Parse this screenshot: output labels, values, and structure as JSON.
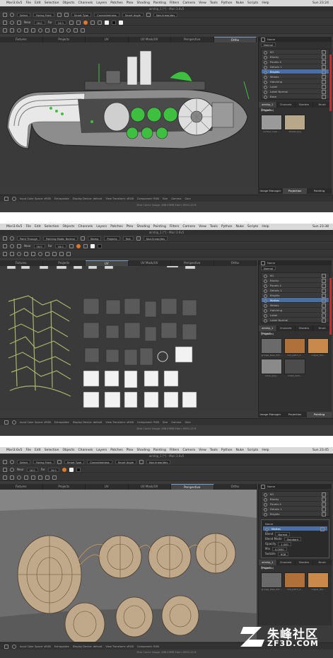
{
  "menu": [
    "Mari3.6v5",
    "File",
    "Edit",
    "Selection",
    "Objects",
    "Channels",
    "Layers",
    "Patches",
    "Ptex",
    "Shading",
    "Painting",
    "Filters",
    "Camera",
    "View",
    "Tools",
    "Python",
    "Nuke",
    "Scripts",
    "Help"
  ],
  "panels": [
    {
      "clock": "Sun 23:24",
      "title": "airship_1 [*] - Mari 3.6v5",
      "toolbar1": {
        "select": "Select",
        "mode": "Facing Front",
        "smart_type": "Smart Type",
        "mode2": "Connectedness",
        "smart_angle": "Smart Angle",
        "preset": "Non-linear/dev"
      },
      "toolbar2": {
        "near": "Near",
        "far": "Far",
        "size": "16.0",
        "flow": "Flow"
      },
      "tabs": [
        "Fixtures",
        "Projects",
        "UV",
        "UV Mask/UV",
        "Perspective",
        "Ortho"
      ],
      "status": {
        "input": "Input Color Space: sRGB",
        "extrapolate": "Extrapolate",
        "display": "Display Device: default",
        "view": "View Transform: sRGB",
        "component": "Component: RGB",
        "size": "Size",
        "gamma": "Gamma",
        "gain": "Gain"
      },
      "cache": "Disk Cache Usage: 486.49MB   Eden: 6952.20 B",
      "side": {
        "title": "Name",
        "layers": [
          "KO",
          "Blocky",
          "Panels 4",
          "Details 1",
          "Brights",
          "Metals",
          "Hatching",
          "Label",
          "Label Normal",
          "Base"
        ],
        "selected": 4,
        "tabs": [
          "airship_1 (Projects)",
          "Channels",
          "Shaders",
          "Brush"
        ],
        "project_label": "Project",
        "thumbs": [
          "surface noise ...",
          "streaks.png"
        ],
        "bottom_tabs": [
          "Image Manager",
          "Projection",
          "Painting"
        ]
      }
    },
    {
      "clock": "Sun 23:38",
      "title": "airship_1 [*] - Mari 3.6v5",
      "toolbar1": {
        "select": "Paint Through",
        "mode": "Painting Mode: Normal",
        "smart_type": "Stamp",
        "mode2": "Projects",
        "smart_angle": "Text",
        "preset": "Non-linear/dev"
      },
      "toolbar2": {
        "near": "Near",
        "far": "Far",
        "size": "16.0",
        "flow": "Flow"
      },
      "tabs": [
        "Fixtures",
        "Projects",
        "UV",
        "UV Mask/UV",
        "Perspective",
        "Ortho"
      ],
      "status": {
        "input": "Input Color Space: sRGB",
        "extrapolate": "Extrapolate",
        "display": "Display Device: default",
        "view": "View Transform: sRGB",
        "component": "Component: RGB",
        "size": "Size",
        "gamma": "Gamma",
        "gain": "Gain"
      },
      "cache": "Disk Cache Usage: 486.49MB   Eden: 6952.20 B",
      "side": {
        "title": "Name",
        "layers": [
          "KO",
          "Blocky",
          "Panels 4",
          "Details 1",
          "Brights",
          "Mattes",
          "Metals",
          "Hatching",
          "Label",
          "Label Normal"
        ],
        "selected": 5,
        "tabs": [
          "airship_1 (Projects)",
          "Channels",
          "Shaders",
          "Brush"
        ],
        "project_label": "Project",
        "thumbs": [
          "grunge_base_dirt...",
          "rust_patch_2...",
          "copper_tile...",
          "noise_grey...",
          "metal_dark..."
        ],
        "bottom_tabs": [
          "Image Manager",
          "Projection",
          "Painting"
        ]
      }
    },
    {
      "clock": "Sun 23:45",
      "title": "airship_1 [*] - Mari 3.6v5",
      "toolbar1": {
        "select": "Select",
        "mode": "Facing Front",
        "smart_type": "Smart Type",
        "mode2": "Connectedness",
        "smart_angle": "Smart Angle",
        "preset": "Non-linear/dev"
      },
      "toolbar2": {
        "near": "Near",
        "far": "Far",
        "size": "16.0",
        "flow": "Flow"
      },
      "tabs": [
        "Fixtures",
        "Projects",
        "UV",
        "UV Mask/UV",
        "Perspective",
        "Ortho"
      ],
      "status": {
        "input": "Input Color Space: sRGB",
        "extrapolate": "Extrapolate",
        "display": "Display Device: default",
        "view": "View Transform: sRGB",
        "component": "Component: RGB",
        "size": "Size",
        "gamma": "Gamma",
        "gain": "Gain"
      },
      "cache": "Disk Cache Usage: 486.49MB   Eden: 6952.20 B",
      "side": {
        "title": "Name",
        "layers": [
          "KO",
          "Blocky",
          "Panels 4",
          "Details 1",
          "Brights"
        ],
        "selected": -1,
        "popup_title": "Name",
        "popup_layer": "Mattes",
        "popup_fields": [
          {
            "label": "Blend",
            "value": "Normal"
          },
          {
            "label": "Blend Mode",
            "value": "Standard"
          },
          {
            "label": "Opacity",
            "value": "1.000"
          },
          {
            "label": "Mix",
            "value": "0.0000"
          },
          {
            "label": "Swizzle",
            "value": "RGB"
          }
        ],
        "tabs": [
          "airship_1 (Projects)",
          "Channels",
          "Shaders",
          "Brush"
        ],
        "project_label": "Project",
        "thumbs": [
          "grunge_base_dirt...",
          "rust_patch_2...",
          "copper_tile..."
        ],
        "bottom_tabs": [
          "Image Manager",
          "Projection",
          "Painting"
        ]
      }
    }
  ],
  "watermark": {
    "text": "朱峰社区",
    "url": "ZF3D.COM"
  },
  "colors": {
    "bg": "#3b3b3b",
    "accent_green": "#3fbf3f",
    "menubar": "#d9d9d9",
    "selection": "#4a6fa5",
    "orange": "#e0782a"
  }
}
